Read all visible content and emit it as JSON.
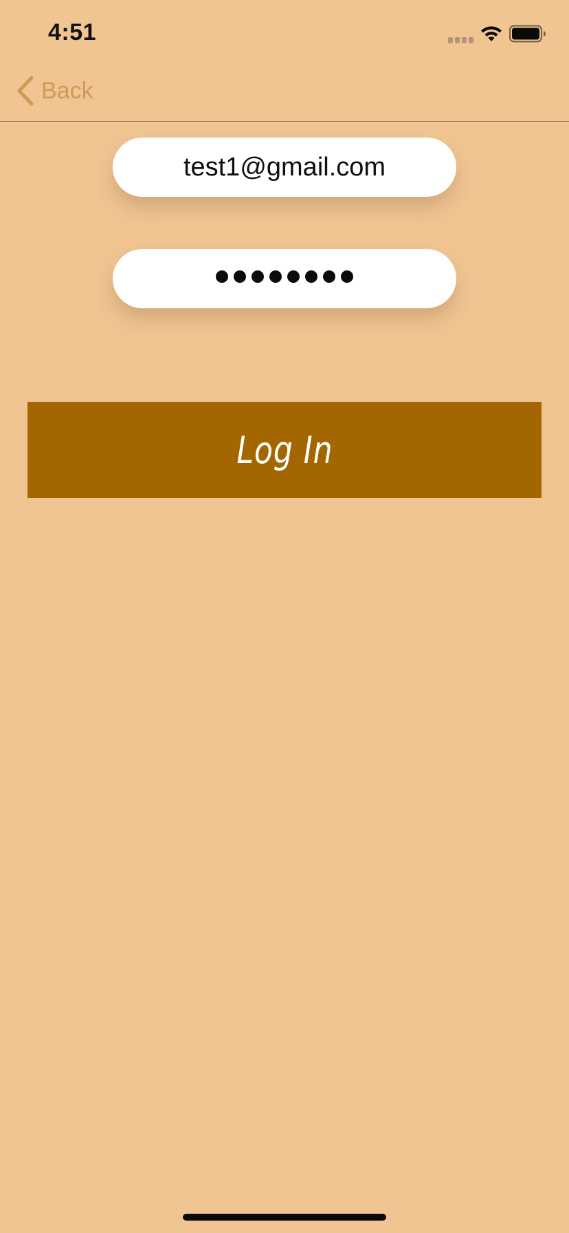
{
  "status_bar": {
    "time": "4:51",
    "signal_icon": "cellular-signal-icon",
    "wifi_icon": "wifi-icon",
    "battery_icon": "battery-full-icon"
  },
  "nav": {
    "back_label": "Back",
    "back_icon": "chevron-left-icon"
  },
  "form": {
    "email_value": "test1@gmail.com",
    "password_mask_length": 8,
    "login_label": "Log In"
  },
  "colors": {
    "background": "#F0C592",
    "accent": "#CE9A58",
    "button": "#A46600",
    "field": "#FFFFFF"
  }
}
